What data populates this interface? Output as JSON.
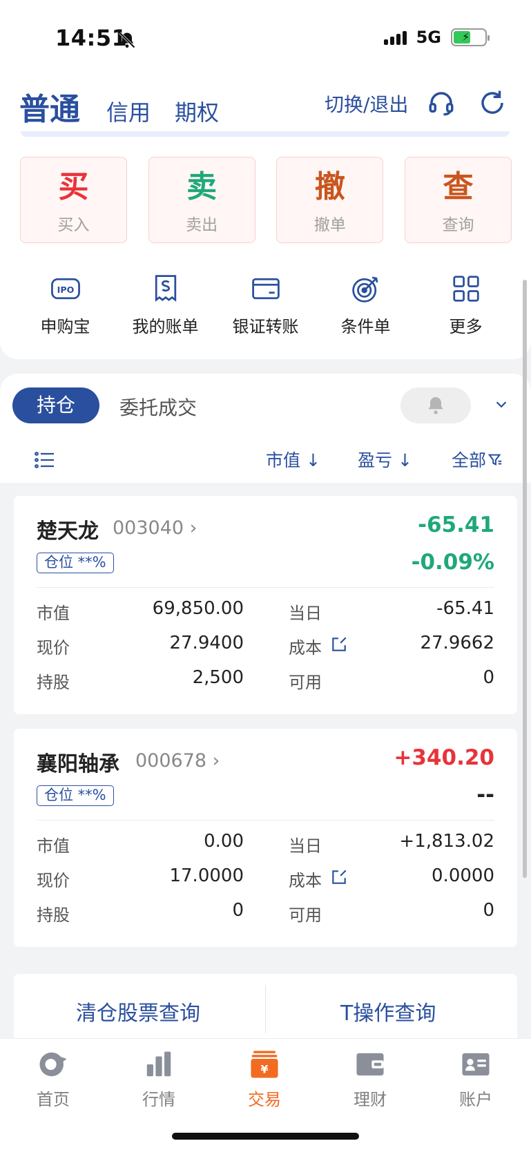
{
  "status_bar": {
    "time": "14:51",
    "network": "5G"
  },
  "header": {
    "tabs": [
      "普通",
      "信用",
      "期权"
    ],
    "switch_label": "切换/退出"
  },
  "actions": [
    {
      "big": "买",
      "small": "买入",
      "color": "#e8333a"
    },
    {
      "big": "卖",
      "small": "卖出",
      "color": "#1fa87a"
    },
    {
      "big": "撤",
      "small": "撤单",
      "color": "#c9561e"
    },
    {
      "big": "查",
      "small": "查询",
      "color": "#c9561e"
    }
  ],
  "tools": [
    {
      "label": "申购宝",
      "icon": "ipo-icon"
    },
    {
      "label": "我的账单",
      "icon": "bill-icon"
    },
    {
      "label": "银证转账",
      "icon": "card-icon"
    },
    {
      "label": "条件单",
      "icon": "target-icon"
    },
    {
      "label": "更多",
      "icon": "grid-icon"
    }
  ],
  "positions_panel": {
    "active_tab": "持仓",
    "inactive_tab": "委托成交",
    "sort_market_value": "市值 ↓",
    "sort_pnl": "盈亏 ↓",
    "filter_all": "全部"
  },
  "holdings": [
    {
      "name": "楚天龙",
      "code": "003040 ›",
      "pnl": "-65.41",
      "pnl_pct": "-0.09%",
      "tag": "仓位 **%",
      "labels": {
        "market_value": "市值",
        "today": "当日",
        "price": "现价",
        "cost": "成本",
        "shares": "持股",
        "available": "可用"
      },
      "market_value": "69,850.00",
      "today_pnl": "-65.41",
      "price": "27.9400",
      "cost": "27.9662",
      "shares": "2,500",
      "available": "0"
    },
    {
      "name": "襄阳轴承",
      "code": "000678 ›",
      "pnl": "+340.20",
      "pnl_pct": "--",
      "tag": "仓位 **%",
      "labels": {
        "market_value": "市值",
        "today": "当日",
        "price": "现价",
        "cost": "成本",
        "shares": "持股",
        "available": "可用"
      },
      "market_value": "0.00",
      "today_pnl": "+1,813.02",
      "price": "17.0000",
      "cost": "0.0000",
      "shares": "0",
      "available": "0"
    }
  ],
  "bottom_links": {
    "left": "清仓股票查询",
    "right": "T操作查询"
  },
  "tabbar": [
    {
      "label": "首页",
      "icon": "home-icon"
    },
    {
      "label": "行情",
      "icon": "chart-icon"
    },
    {
      "label": "交易",
      "icon": "trade-icon",
      "active": true
    },
    {
      "label": "理财",
      "icon": "wallet-icon"
    },
    {
      "label": "账户",
      "icon": "account-icon"
    }
  ]
}
